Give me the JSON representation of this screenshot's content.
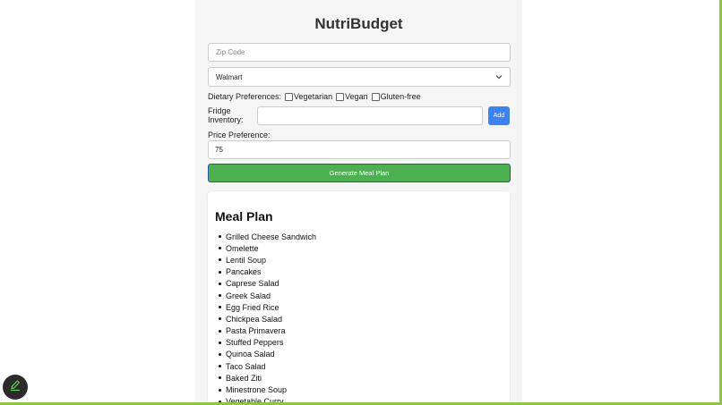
{
  "app": {
    "title": "NutriBudget"
  },
  "form": {
    "zip_placeholder": "Zip Code",
    "zip_value": "",
    "store_selected": "Walmart",
    "dietary_label": "Dietary Preferences:",
    "dietary_options": [
      "Vegetarian",
      "Vegan",
      "Gluten-free"
    ],
    "fridge_label": "Fridge Inventory:",
    "fridge_value": "",
    "add_label": "Add",
    "price_label": "Price Preference:",
    "price_value": "75",
    "generate_label": "Generate Meal Plan"
  },
  "meal_plan": {
    "title": "Meal Plan",
    "items": [
      "Grilled Cheese Sandwich",
      "Omelette",
      "Lentil Soup",
      "Pancakes",
      "Caprese Salad",
      "Greek Salad",
      "Egg Fried Rice",
      "Chickpea Salad",
      "Pasta Primavera",
      "Stuffed Peppers",
      "Quinoa Salad",
      "Taco Salad",
      "Baked Ziti",
      "Minestrone Soup",
      "Vegetable Curry"
    ]
  },
  "colors": {
    "add_button": "#3b82f6",
    "generate_button": "#4caf50",
    "page_edge": "#8dc63f"
  },
  "icons": {
    "fab": "pencil-icon",
    "select": "chevron-down-icon"
  }
}
